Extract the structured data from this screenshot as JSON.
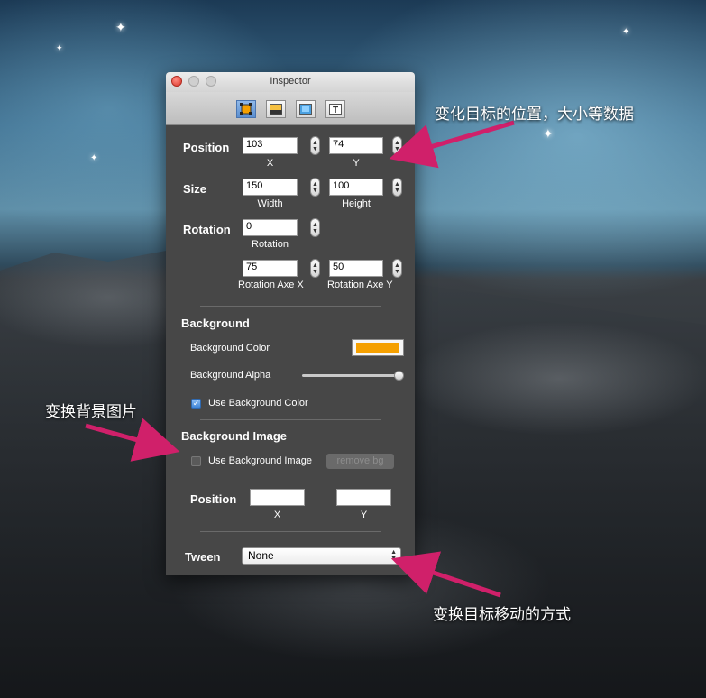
{
  "window": {
    "title": "Inspector"
  },
  "toolbar": {
    "buttons": [
      "transform-icon",
      "background-icon",
      "image-icon",
      "text-icon"
    ],
    "active_index": 0
  },
  "position": {
    "label": "Position",
    "x": "103",
    "y": "74",
    "x_label": "X",
    "y_label": "Y"
  },
  "size": {
    "label": "Size",
    "width": "150",
    "height": "100",
    "width_label": "Width",
    "height_label": "Height"
  },
  "rotation": {
    "label": "Rotation",
    "value": "0",
    "value_label": "Rotation",
    "axe_x": "75",
    "axe_y": "50",
    "axe_x_label": "Rotation Axe X",
    "axe_y_label": "Rotation Axe Y"
  },
  "background": {
    "section_title": "Background",
    "color_label": "Background Color",
    "color": "#f5a000",
    "alpha_label": "Background Alpha",
    "alpha_value": 1.0,
    "use_color_label": "Use Background Color",
    "use_color_checked": true
  },
  "background_image": {
    "section_title": "Background Image",
    "use_label": "Use Background Image",
    "use_checked": false,
    "remove_label": "remove bg",
    "position_label": "Position",
    "x": "",
    "y": "",
    "x_label": "X",
    "y_label": "Y"
  },
  "tween": {
    "label": "Tween",
    "value": "None"
  },
  "annotations": {
    "position_note": "变化目标的位置，大小等数据",
    "image_note": "变换背景图片",
    "tween_note": "变换目标移动的方式"
  },
  "colors": {
    "arrow": "#d0206a",
    "panel": "#474747"
  }
}
